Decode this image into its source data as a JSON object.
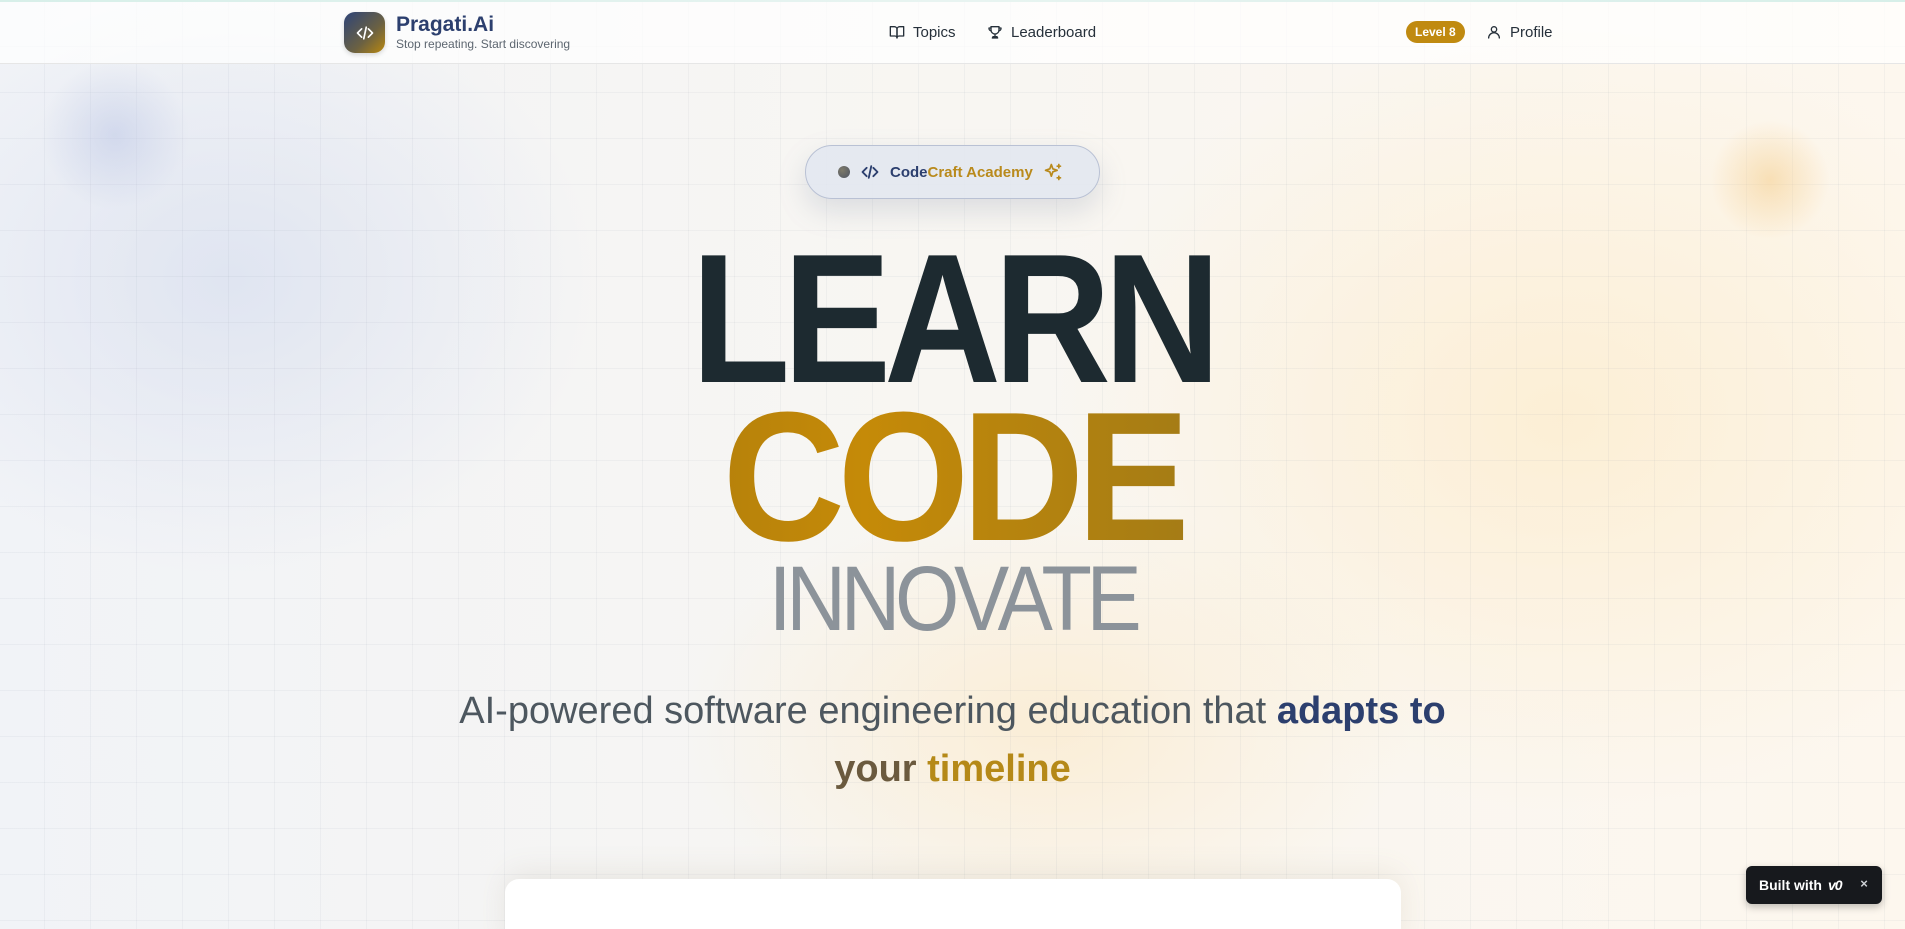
{
  "header": {
    "brand_name": "Pragati.Ai",
    "tagline": "Stop repeating. Start discovering",
    "nav": {
      "topics": "Topics",
      "leaderboard": "Leaderboard",
      "profile": "Profile"
    },
    "level_badge": "Level 8"
  },
  "hero": {
    "pill_part1": "Code",
    "pill_part2": "Craft Academy",
    "line1": "LEARN",
    "line2": "CODE",
    "line3": "INNOVATE",
    "subtitle_plain": "AI-powered software engineering education that ",
    "subtitle_highlight1": "adapts to",
    "subtitle_highlight2_a": "your ",
    "subtitle_highlight2_b": "timeline"
  },
  "badge": {
    "built_with": "Built with",
    "brand": "v0",
    "close": "×"
  },
  "colors": {
    "brand_blue": "#2c3f6e",
    "brand_gold": "#c08a10",
    "ink": "#1d2a30",
    "muted": "#8c939a"
  },
  "icons": [
    "code-icon",
    "book-icon",
    "trophy-icon",
    "user-icon",
    "sparkles-icon",
    "close-icon"
  ]
}
